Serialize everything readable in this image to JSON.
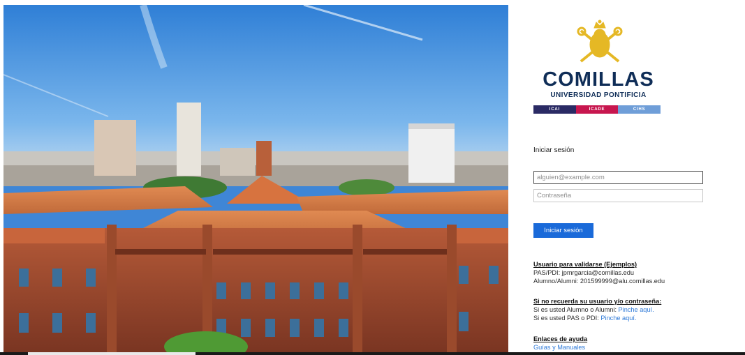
{
  "brand": {
    "name": "COMILLAS",
    "subtitle": "UNIVERSIDAD PONTIFICIA",
    "schools": [
      {
        "label": "ICAI",
        "color": "#2a2a64"
      },
      {
        "label": "ICADE",
        "color": "#c7164e"
      },
      {
        "label": "CIHS",
        "color": "#6f9ed8"
      }
    ],
    "navy": "#0f2d57",
    "gold": "#e5b825"
  },
  "login": {
    "title": "Iniciar sesión",
    "email_placeholder": "alguien@example.com",
    "password_placeholder": "Contraseña",
    "submit_label": "Iniciar sesión",
    "button_color": "#1a6ad9"
  },
  "examples": {
    "heading": "Usuario para validarse (Ejemplos)",
    "lines": [
      "PAS/PDI: jpmrgarcia@comillas.edu",
      "Alumno/Alumni: 201599999@alu.comillas.edu"
    ]
  },
  "recovery": {
    "heading": "Si no recuerda su usuario y/o contraseña:",
    "line1_text": "Si es usted Alumno o Alumni: ",
    "line1_link": "Pinche aquí.",
    "line2_text": "Si es usted PAS o PDI: ",
    "line2_link": "Pinche aquí."
  },
  "help": {
    "heading": "Enlaces de ayuda",
    "link": "Guías y Manuales"
  },
  "icons": [
    "university-crest-icon"
  ]
}
